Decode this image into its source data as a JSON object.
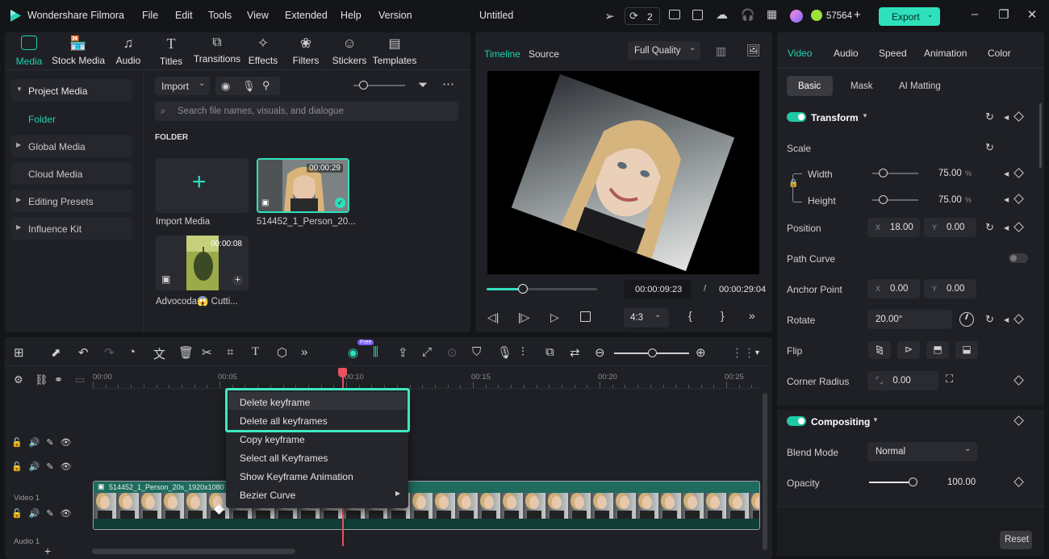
{
  "app": {
    "name": "Wondershare Filmora",
    "menu": [
      "File",
      "Edit",
      "Tools",
      "View",
      "Extended",
      "Help",
      "Version"
    ],
    "project_title": "Untitled",
    "collab_count": "2",
    "credits": "57564",
    "export_label": "Export"
  },
  "media_panel": {
    "tabs": [
      "Media",
      "Stock Media",
      "Audio",
      "Titles",
      "Transitions",
      "Effects",
      "Filters",
      "Stickers",
      "Templates"
    ],
    "active_tab": "Media",
    "sidebar": [
      "Project Media",
      "Folder",
      "Global Media",
      "Cloud Media",
      "Editing Presets",
      "Influence Kit"
    ],
    "import_label": "Import",
    "search_placeholder": "Search file names, visuals, and dialogue",
    "folder_label": "FOLDER",
    "items": [
      {
        "name": "Import Media"
      },
      {
        "name": "514452_1_Person_20...",
        "duration": "00:00:29"
      },
      {
        "name": "Advocoda😱 Cutti...",
        "duration": "00:00:08"
      }
    ]
  },
  "preview": {
    "tabs": [
      "Timeline",
      "Source"
    ],
    "quality": "Full Quality",
    "current_time": "00:00:09:23",
    "separator": "/",
    "total_time": "00:00:29:04",
    "progress": 0.33,
    "ratio": "4:3"
  },
  "properties": {
    "tabs": [
      "Video",
      "Audio",
      "Speed",
      "Animation",
      "Color"
    ],
    "subtabs": [
      "Basic",
      "Mask",
      "AI Matting"
    ],
    "transform_label": "Transform",
    "scale_label": "Scale",
    "width_label": "Width",
    "width_value": "75.00",
    "height_label": "Height",
    "height_value": "75.00",
    "percent": "%",
    "position_label": "Position",
    "pos_x_label": "X",
    "pos_x": "18.00",
    "pos_y_label": "Y",
    "pos_y": "0.00",
    "path_curve_label": "Path Curve",
    "anchor_label": "Anchor Point",
    "anchor_x": "0.00",
    "anchor_y": "0.00",
    "rotate_label": "Rotate",
    "rotate_value": "20.00°",
    "flip_label": "Flip",
    "corner_label": "Corner Radius",
    "corner_value": "0.00",
    "compositing_label": "Compositing",
    "blend_label": "Blend Mode",
    "blend_value": "Normal",
    "opacity_label": "Opacity",
    "opacity_value": "100.00",
    "reset_label": "Reset"
  },
  "timeline": {
    "ruler": [
      "00:00",
      "00:05",
      "00:10",
      "00:15",
      "00:20",
      "00:25"
    ],
    "free_badge": "Free",
    "track_video_label": "Video 1",
    "track_audio_label": "Audio 1",
    "clip_label": "514452_1_Person_20s_1920x1080 4"
  },
  "context_menu": {
    "items": [
      "Delete keyframe",
      "Delete all keyframes",
      "Copy keyframe",
      "Select all Keyframes",
      "Show Keyframe Animation",
      "Bezier Curve"
    ]
  },
  "colors": {
    "accent": "#1fd0b0",
    "highlight": "#3ee8c2",
    "playhead": "#e9515c",
    "panel": "#1f2025"
  }
}
